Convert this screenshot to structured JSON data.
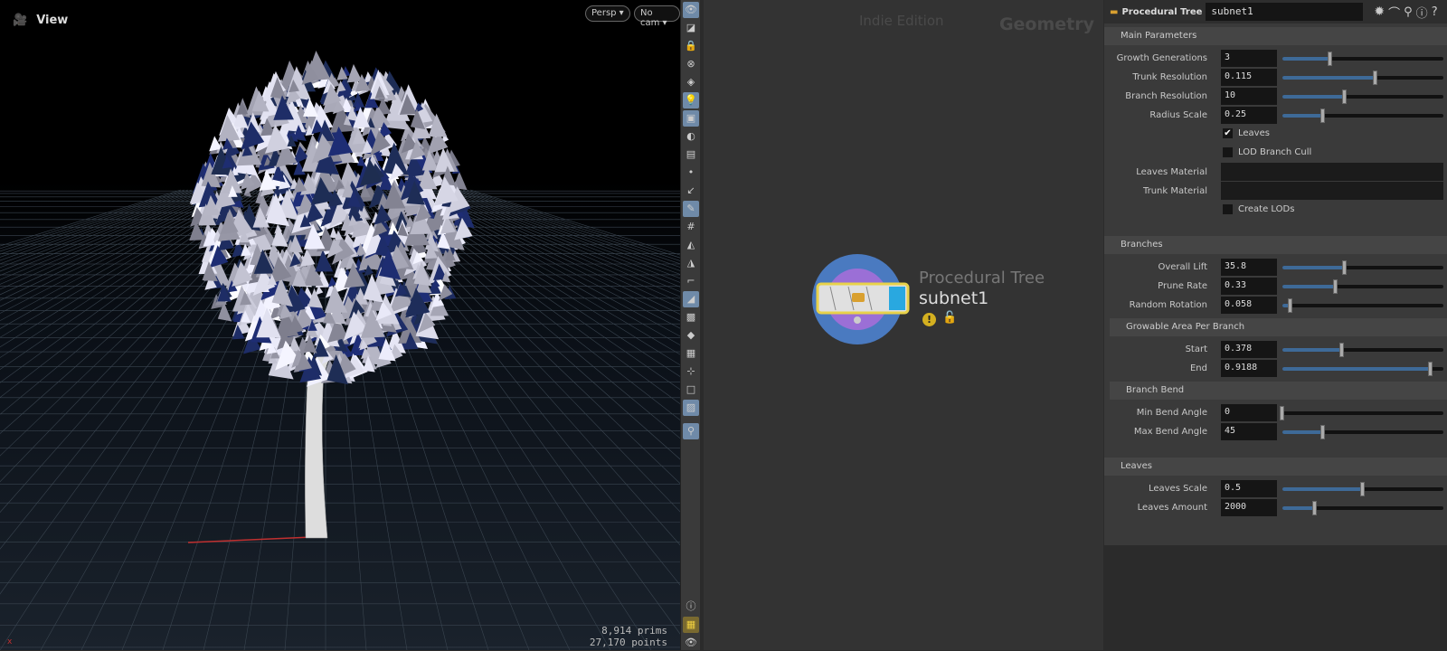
{
  "viewport": {
    "title": "View",
    "persp_label": "Persp",
    "cam_label": "No cam",
    "stats": {
      "prims": "8,914  prims",
      "points": "27,170 points"
    },
    "watermark": "Indie Edition"
  },
  "network": {
    "edition": "Indie Edition",
    "context": "Geometry",
    "node": {
      "type": "Procedural Tree",
      "name": "subnet1"
    }
  },
  "params": {
    "node_type": "Procedural Tree",
    "node_name": "subnet1",
    "sections": {
      "main": "Main Parameters",
      "branches": "Branches",
      "growable": "Growable Area Per Branch",
      "bend": "Branch Bend",
      "leaves": "Leaves"
    },
    "main": [
      {
        "label": "Growth Generations",
        "value": "3",
        "slider": 0.3
      },
      {
        "label": "Trunk Resolution",
        "value": "0.115",
        "slider": 0.58
      },
      {
        "label": "Branch Resolution",
        "value": "10",
        "slider": 0.39
      },
      {
        "label": "Radius Scale",
        "value": "0.25",
        "slider": 0.25
      }
    ],
    "toggles": {
      "leaves": {
        "label": "Leaves",
        "checked": true
      },
      "lod_cull": {
        "label": "LOD Branch Cull",
        "checked": false
      },
      "create_lods": {
        "label": "Create LODs",
        "checked": false
      }
    },
    "leaves_material": {
      "label": "Leaves Material",
      "value": ""
    },
    "trunk_material": {
      "label": "Trunk Material",
      "value": ""
    },
    "branches": [
      {
        "label": "Overall Lift",
        "value": "35.8",
        "slider": 0.39
      },
      {
        "label": "Prune Rate",
        "value": "0.33",
        "slider": 0.33
      },
      {
        "label": "Random Rotation",
        "value": "0.058",
        "slider": 0.05
      }
    ],
    "growable": [
      {
        "label": "Start",
        "value": "0.378",
        "slider": 0.37
      },
      {
        "label": "End",
        "value": "0.9188",
        "slider": 0.92
      }
    ],
    "bend": [
      {
        "label": "Min Bend Angle",
        "value": "0",
        "slider": 0
      },
      {
        "label": "Max Bend Angle",
        "value": "45",
        "slider": 0.25
      }
    ],
    "leaves": [
      {
        "label": "Leaves Scale",
        "value": "0.5",
        "slider": 0.5
      },
      {
        "label": "Leaves Amount",
        "value": "2000",
        "slider": 0.2
      }
    ]
  },
  "colors": {
    "slider_fill": "#3e6a98",
    "node_ring": "#4a7ac0",
    "node_inner": "#9b6fd6",
    "node_flag": "#29a8e0",
    "node_outline": "#e8d24a"
  }
}
